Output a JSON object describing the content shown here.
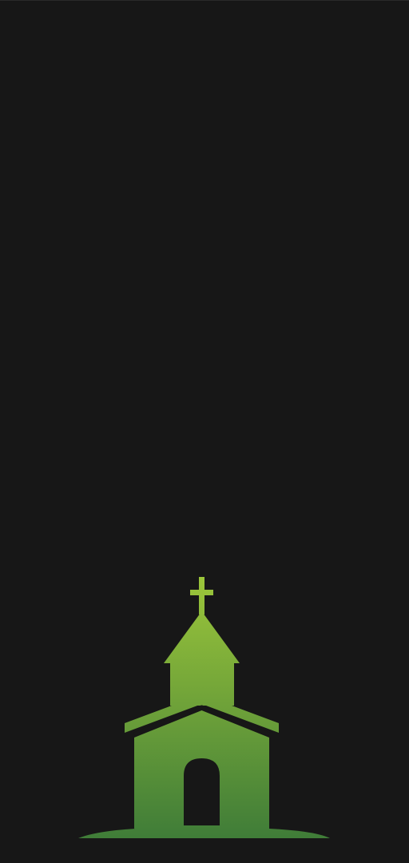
{
  "screen": {
    "background": "#171717"
  },
  "illustration": {
    "icon": "church-icon",
    "gradient_top": "#9cc63a",
    "gradient_bottom": "#3f7c38",
    "cutout_color": "#171717"
  }
}
